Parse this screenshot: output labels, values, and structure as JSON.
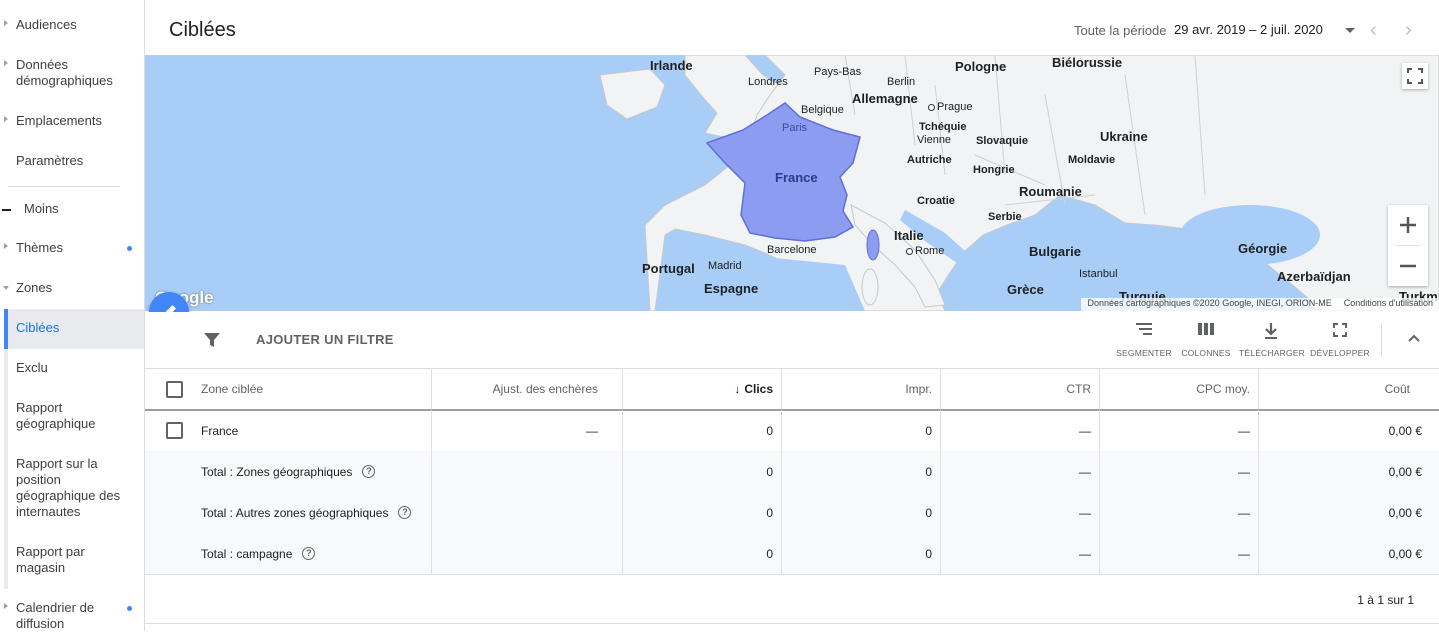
{
  "sidebar": {
    "items": [
      {
        "label": "Audiences",
        "caret": true
      },
      {
        "label": "Données démographiques",
        "caret": true
      },
      {
        "label": "Emplacements",
        "caret": true
      },
      {
        "label": "Paramètres",
        "caret": false
      },
      {
        "label": "Moins"
      },
      {
        "label": "Thèmes",
        "caret": true,
        "dot": true
      },
      {
        "label": "Zones",
        "caret": true
      },
      {
        "label": "Ciblées",
        "active": true
      },
      {
        "label": "Exclu"
      },
      {
        "label": "Rapport géographique"
      },
      {
        "label": "Rapport sur la position géographique des internautes"
      },
      {
        "label": "Rapport par magasin"
      },
      {
        "label": "Calendrier de diffusion",
        "caret": true,
        "dot": true
      }
    ]
  },
  "header": {
    "title": "Ciblées",
    "period_label": "Toute la période",
    "period_value": "29 avr. 2019 – 2 juil. 2020"
  },
  "map": {
    "labels": {
      "irlande": "Irlande",
      "londres": "Londres",
      "paysbas": "Pays-Bas",
      "berlin": "Berlin",
      "pologne": "Pologne",
      "bielorussie": "Biélorussie",
      "belgique": "Belgique",
      "allemagne": "Allemagne",
      "prague": "Prague",
      "paris": "Paris",
      "tchequie": "Tchéquie",
      "vienne": "Vienne",
      "slovaquie": "Slovaquie",
      "ukraine": "Ukraine",
      "france": "France",
      "autriche": "Autriche",
      "moldavie": "Moldavie",
      "hongrie": "Hongrie",
      "roumanie": "Roumanie",
      "croatie": "Croatie",
      "serbie": "Serbie",
      "italie": "Italie",
      "rome": "Rome",
      "bulgarie": "Bulgarie",
      "georgie": "Géorgie",
      "barcelone": "Barcelone",
      "portugal": "Portugal",
      "madrid": "Madrid",
      "espagne": "Espagne",
      "istanbul": "Istanbul",
      "azerbaidjan": "Azerbaïdjan",
      "grece": "Grèce",
      "turquie": "Turquie",
      "turkm": "Turkm"
    },
    "google": "Google",
    "attribution": "Données cartographiques ©2020 Google, INEGI, ORION-ME",
    "terms": "Conditions d'utilisation",
    "water_color": "#a8cdf6",
    "land_color": "#f1f3f4",
    "highlight_color": "#8c9cf0"
  },
  "toolbar": {
    "add_filter": "AJOUTER UN FILTRE",
    "segment": "SEGMENTER",
    "columns": "COLONNES",
    "download": "TÉLÉCHARGER",
    "expand": "DÉVELOPPER"
  },
  "table": {
    "headers": {
      "zone": "Zone ciblée",
      "bid": "Ajust. des enchères",
      "clicks": "Clics",
      "impr": "Impr.",
      "ctr": "CTR",
      "cpc": "CPC moy.",
      "cost": "Coût"
    },
    "rows": [
      {
        "zone": "France",
        "bid": "—",
        "clicks": "0",
        "impr": "0",
        "ctr": "—",
        "cpc": "—",
        "cost": "0,00 €"
      },
      {
        "zone": "Total : Zones géographiques",
        "bid": "",
        "clicks": "0",
        "impr": "0",
        "ctr": "—",
        "cpc": "—",
        "cost": "0,00 €"
      },
      {
        "zone": "Total : Autres zones géographiques",
        "bid": "",
        "clicks": "0",
        "impr": "0",
        "ctr": "—",
        "cpc": "—",
        "cost": "0,00 €"
      },
      {
        "zone": "Total : campagne",
        "bid": "",
        "clicks": "0",
        "impr": "0",
        "ctr": "—",
        "cpc": "—",
        "cost": "0,00 €"
      }
    ],
    "pagination": "1 à 1 sur 1"
  }
}
